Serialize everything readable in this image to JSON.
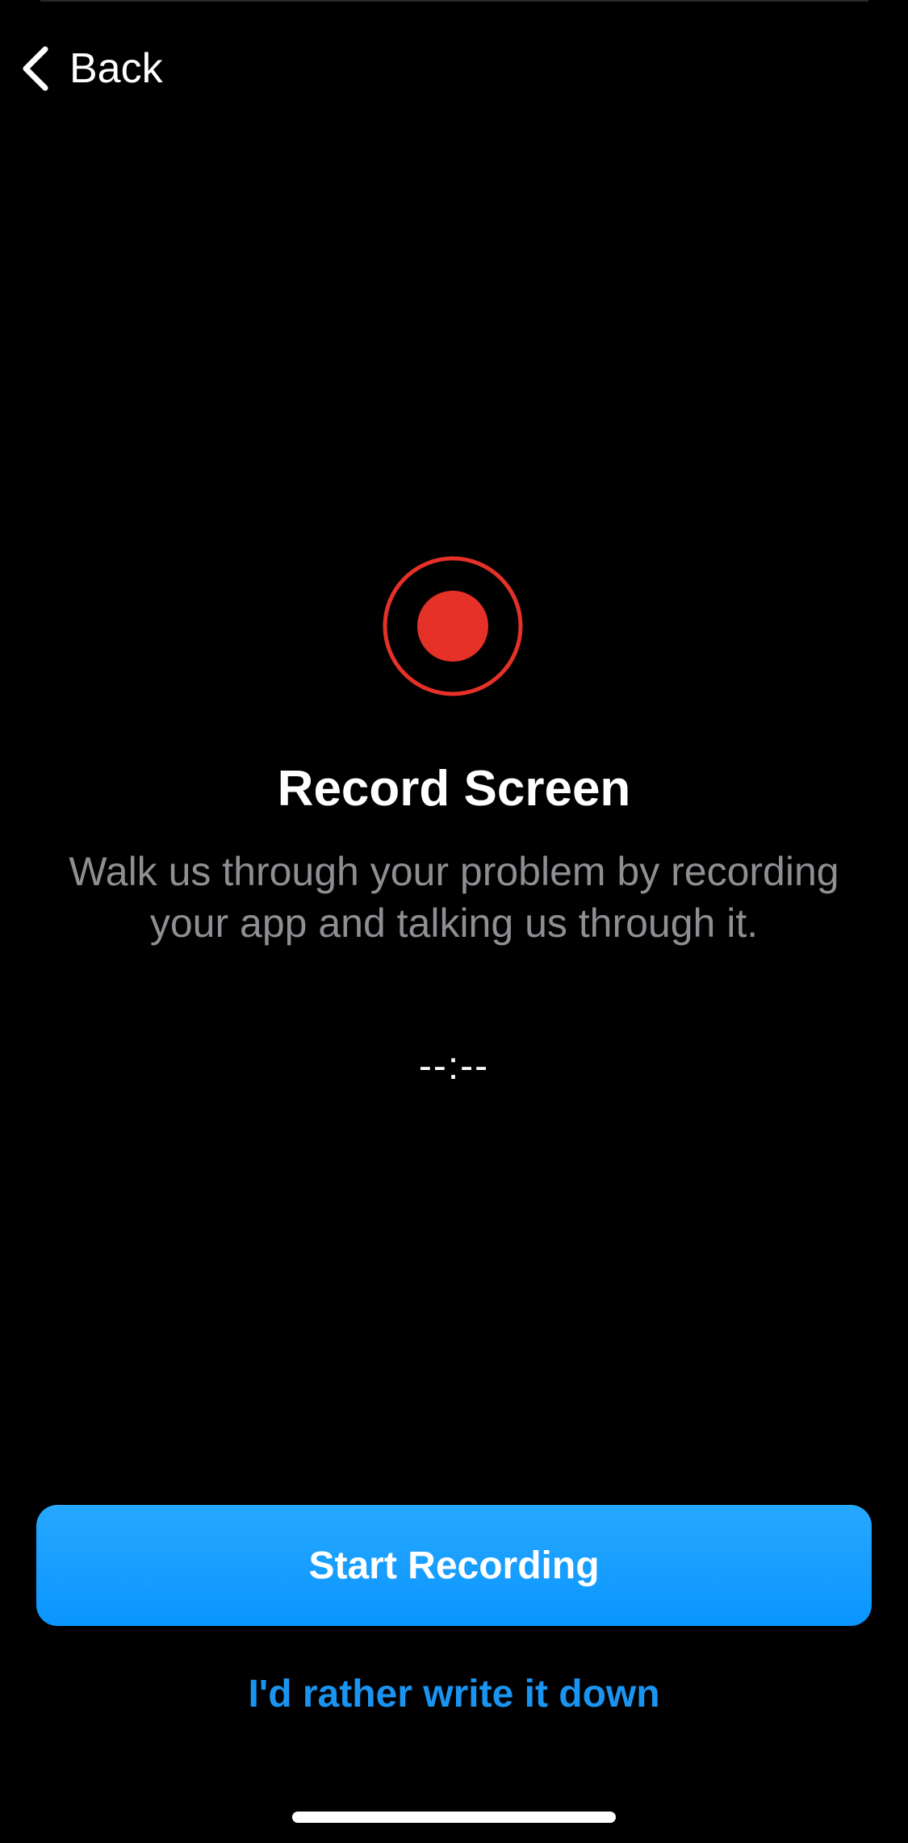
{
  "nav": {
    "back_label": "Back",
    "back_icon": "chevron-left-icon"
  },
  "record": {
    "icon": "record-icon",
    "accent_color": "#E53127",
    "title": "Record Screen",
    "description": "Walk us through your problem by recording your app and talking us through it.",
    "timer": "--:--"
  },
  "actions": {
    "start_label": "Start Recording",
    "start_color": "#0A95FF",
    "write_label": "I'd rather write it down",
    "write_color": "#1A94F0"
  }
}
